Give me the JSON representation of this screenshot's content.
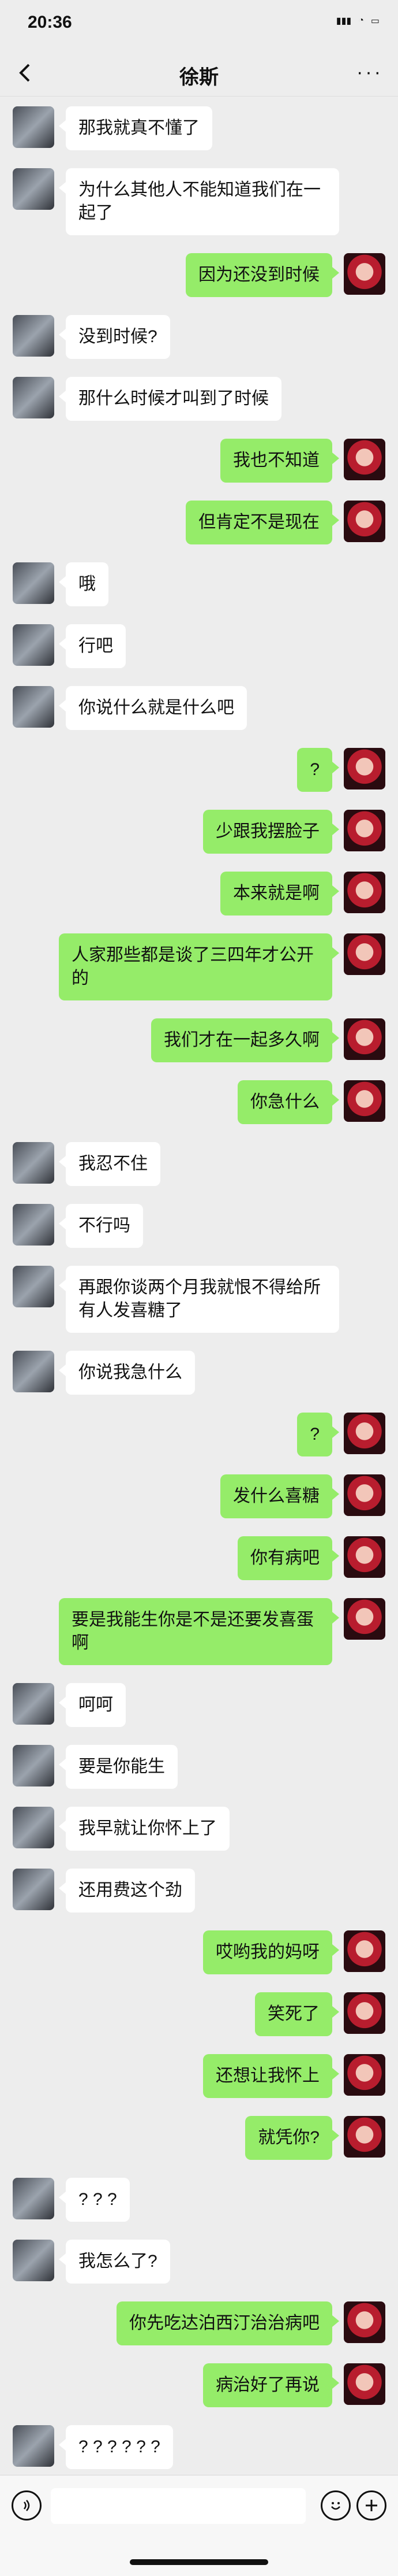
{
  "status": {
    "time": "20:36"
  },
  "nav": {
    "title": "徐斯",
    "more_label": "···"
  },
  "messages": [
    {
      "side": "left",
      "text": "那我就真不懂了"
    },
    {
      "side": "left",
      "text": "为什么其他人不能知道我们在一起了"
    },
    {
      "side": "right",
      "text": "因为还没到时候"
    },
    {
      "side": "left",
      "text": "没到时候?"
    },
    {
      "side": "left",
      "text": "那什么时候才叫到了时候"
    },
    {
      "side": "right",
      "text": "我也不知道"
    },
    {
      "side": "right",
      "text": "但肯定不是现在"
    },
    {
      "side": "left",
      "text": "哦"
    },
    {
      "side": "left",
      "text": "行吧"
    },
    {
      "side": "left",
      "text": "你说什么就是什么吧"
    },
    {
      "side": "right",
      "text": "?"
    },
    {
      "side": "right",
      "text": "少跟我摆脸子"
    },
    {
      "side": "right",
      "text": "本来就是啊"
    },
    {
      "side": "right",
      "text": "人家那些都是谈了三四年才公开的"
    },
    {
      "side": "right",
      "text": "我们才在一起多久啊"
    },
    {
      "side": "right",
      "text": "你急什么"
    },
    {
      "side": "left",
      "text": "我忍不住"
    },
    {
      "side": "left",
      "text": "不行吗"
    },
    {
      "side": "left",
      "text": "再跟你谈两个月我就恨不得给所有人发喜糖了"
    },
    {
      "side": "left",
      "text": "你说我急什么"
    },
    {
      "side": "right",
      "text": "?"
    },
    {
      "side": "right",
      "text": "发什么喜糖"
    },
    {
      "side": "right",
      "text": "你有病吧"
    },
    {
      "side": "right",
      "text": "要是我能生你是不是还要发喜蛋啊"
    },
    {
      "side": "left",
      "text": "呵呵"
    },
    {
      "side": "left",
      "text": "要是你能生"
    },
    {
      "side": "left",
      "text": "我早就让你怀上了"
    },
    {
      "side": "left",
      "text": "还用费这个劲"
    },
    {
      "side": "right",
      "text": "哎哟我的妈呀"
    },
    {
      "side": "right",
      "text": "笑死了"
    },
    {
      "side": "right",
      "text": "还想让我怀上"
    },
    {
      "side": "right",
      "text": "就凭你?"
    },
    {
      "side": "left",
      "text": "? ? ?"
    },
    {
      "side": "left",
      "text": "我怎么了?"
    },
    {
      "side": "right",
      "text": "你先吃达泊西汀治治病吧"
    },
    {
      "side": "right",
      "text": "病治好了再说"
    },
    {
      "side": "left",
      "text": "? ? ? ? ? ?"
    }
  ]
}
